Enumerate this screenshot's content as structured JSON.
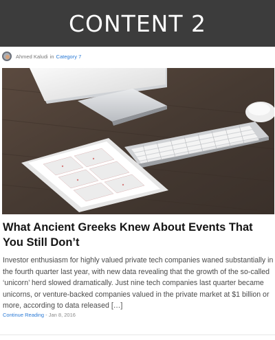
{
  "banner": {
    "title": "CONTENT 2"
  },
  "post": {
    "author": "Ahmed Kaludi",
    "in_label": "in",
    "category": "Category 7",
    "title": "What Ancient Greeks Knew About Events That You Still Don’t",
    "excerpt": "Investor enthusiasm for highly valued private tech companies waned substantially in the fourth quarter last year, with new data revealing that the growth of the so-called ‘unicorn’ herd slowed dramatically. Just nine tech companies last quarter became unicorns, or venture-backed companies valued in the private market at $1 billion or more, according to data released […]",
    "read_more": "Continue Reading",
    "date_separator": " - ",
    "date": "Jan 8, 2016"
  },
  "colors": {
    "banner_bg": "#3c3c3c",
    "link": "#2a7ad6"
  },
  "icons": {
    "avatar": "author-avatar",
    "hero": "desk-photo-imac-keyboard-tablet"
  }
}
